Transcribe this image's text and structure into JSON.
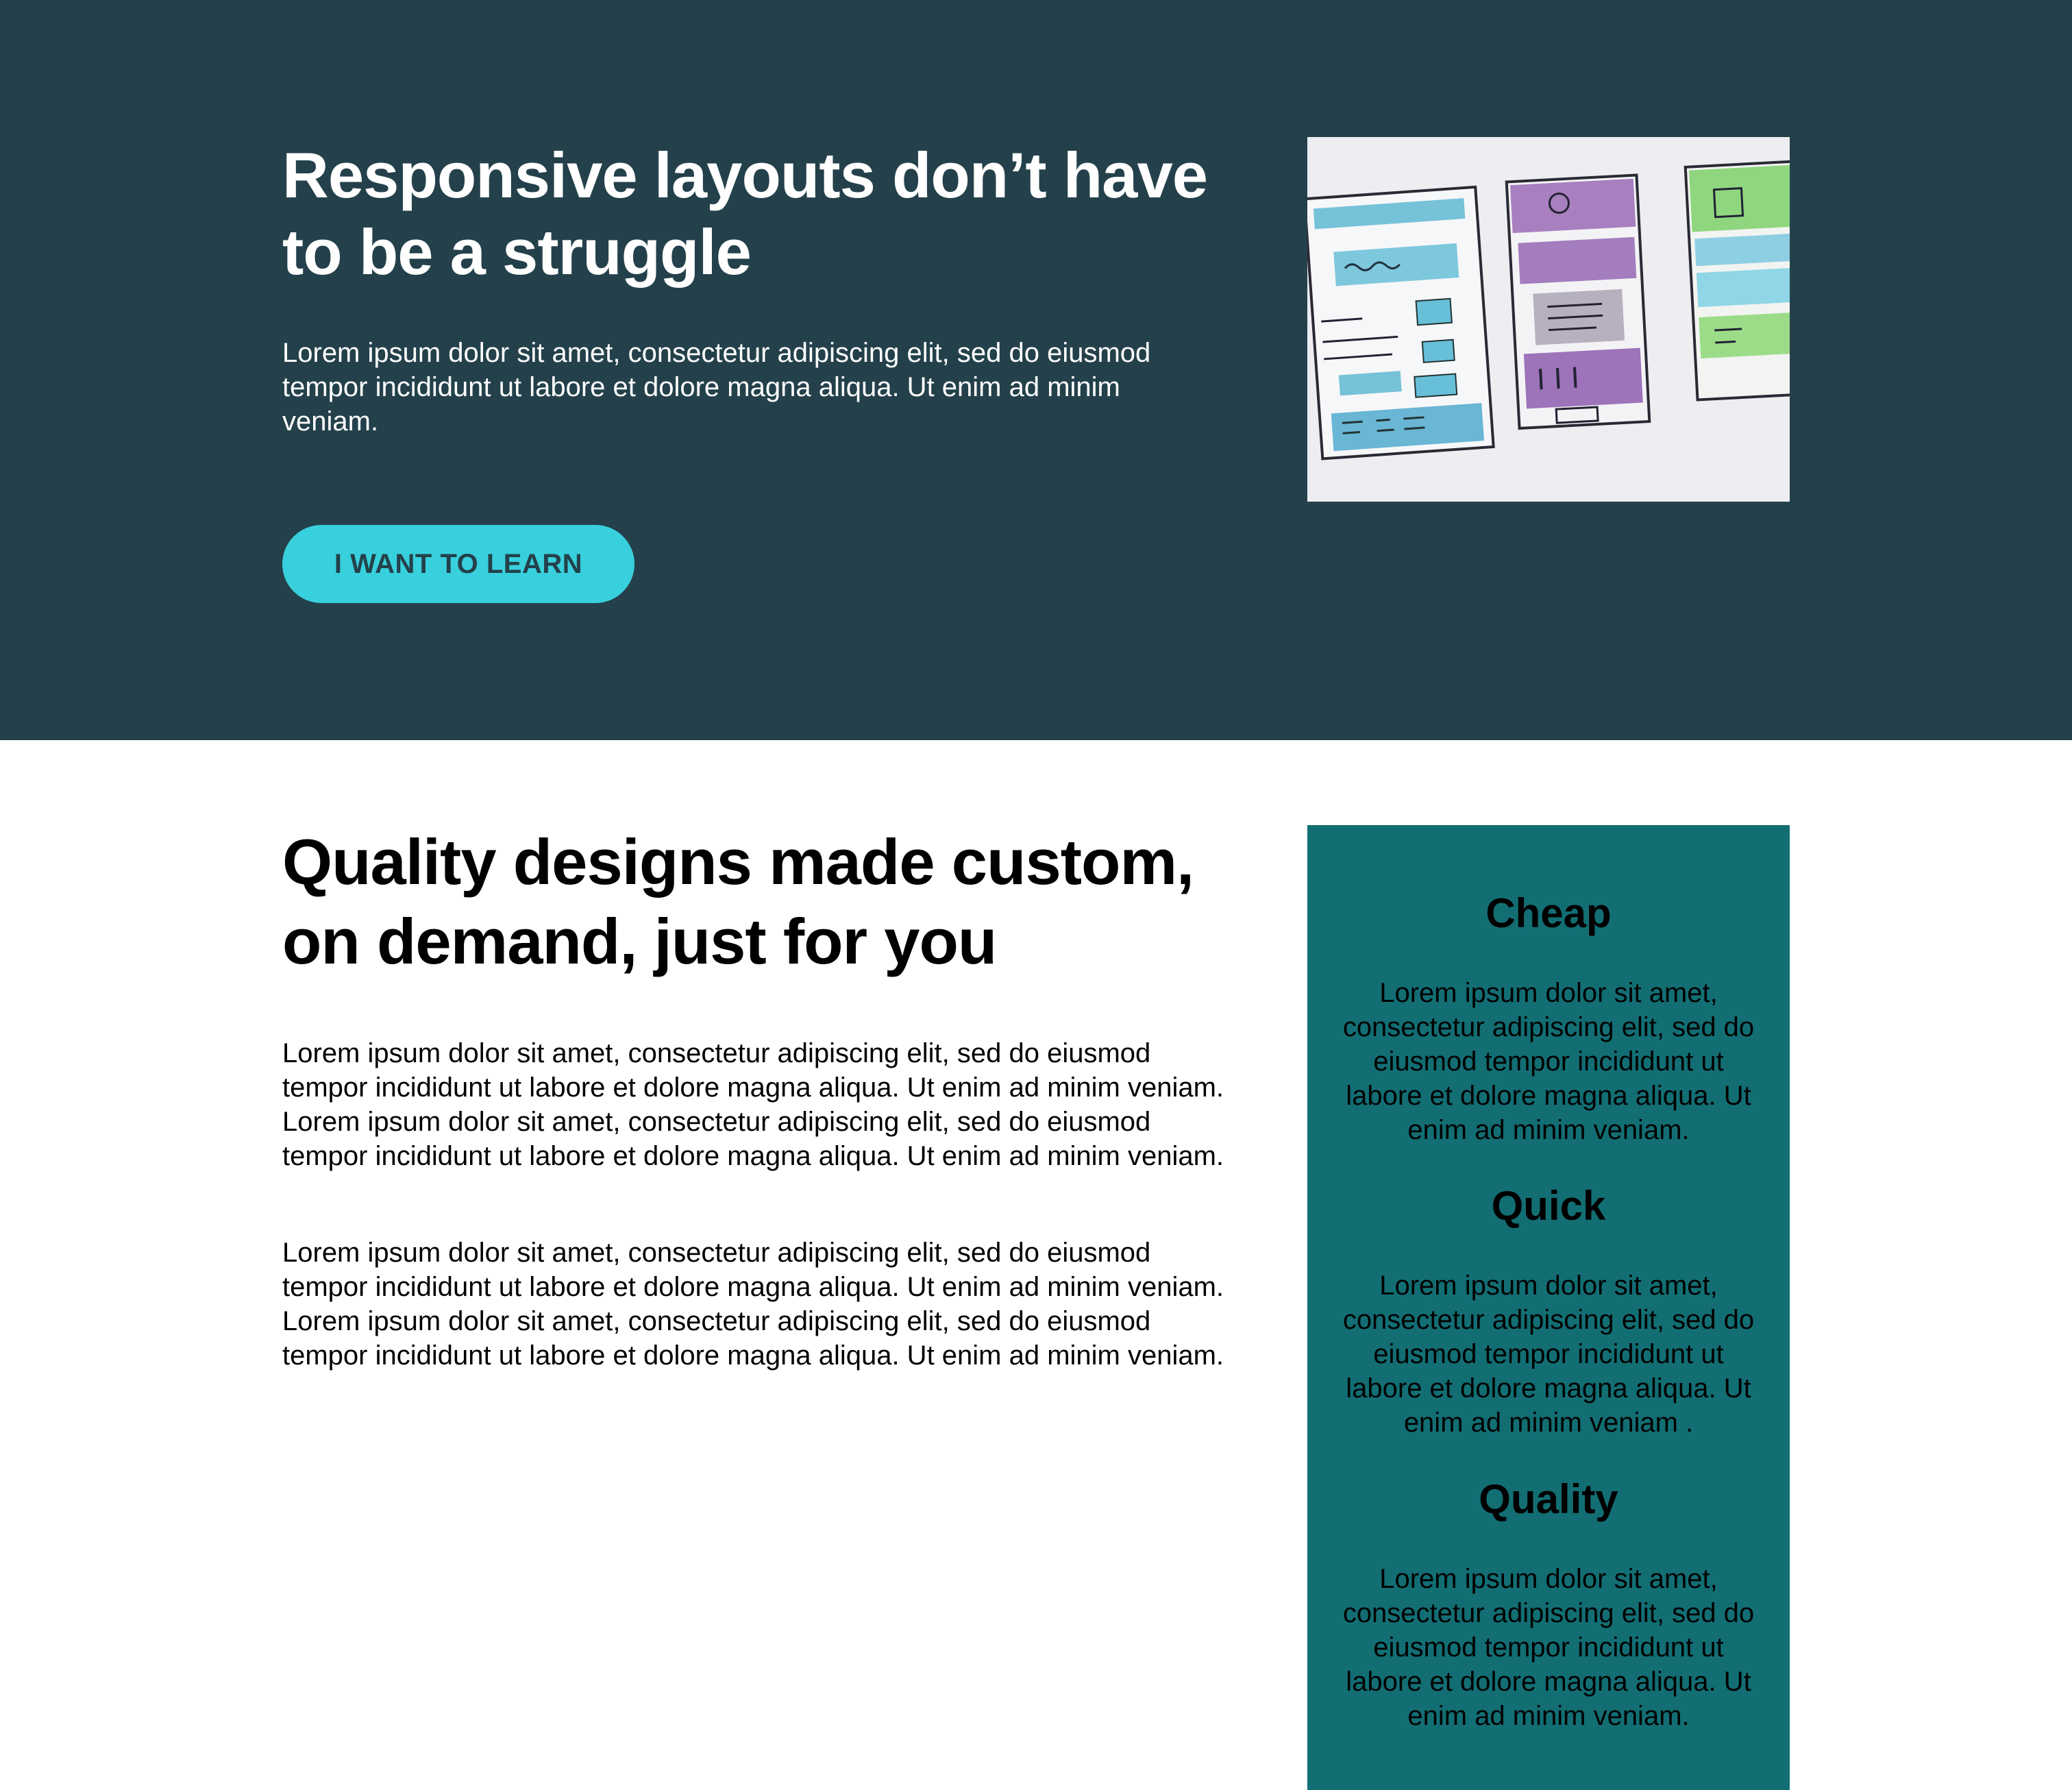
{
  "hero": {
    "title": "Responsive layouts don’t have to be a struggle",
    "text": "Lorem ipsum dolor sit amet, consectetur adipiscing elit, sed do eiusmod tempor incididunt ut labore et dolore magna aliqua. Ut enim ad minim veniam.",
    "cta_label": "I WANT TO LEARN"
  },
  "main": {
    "title": "Quality designs made custom, on demand, just for you",
    "paragraphs": [
      "Lorem ipsum dolor sit amet, consectetur adipiscing elit, sed do eiusmod tempor incididunt ut labore et dolore magna aliqua. Ut enim ad minim veniam. Lorem ipsum dolor sit amet, consectetur adipiscing elit, sed do eiusmod tempor incididunt ut labore et dolore magna aliqua. Ut enim ad minim veniam.",
      "Lorem ipsum dolor sit amet, consectetur adipiscing elit, sed do eiusmod tempor incididunt ut labore et dolore magna aliqua. Ut enim ad minim veniam. Lorem ipsum dolor sit amet, consectetur adipiscing elit, sed do eiusmod tempor incididunt ut labore et dolore magna aliqua. Ut enim ad minim veniam."
    ]
  },
  "sidebar": {
    "features": [
      {
        "title": "Cheap",
        "text": "Lorem ipsum dolor sit amet, consectetur adipiscing elit, sed do eiusmod tempor incididunt ut labore et dolore magna aliqua. Ut enim ad minim veniam."
      },
      {
        "title": "Quick",
        "text": "Lorem ipsum dolor sit amet, consectetur adipiscing elit, sed do eiusmod tempor incididunt ut labore et dolore magna aliqua. Ut enim ad minim veniam ."
      },
      {
        "title": "Quality",
        "text": "Lorem ipsum dolor sit amet, consectetur adipiscing elit, sed do eiusmod tempor incididunt ut labore et dolore magna aliqua. Ut enim ad minim veniam."
      }
    ]
  },
  "colors": {
    "hero_background": "#24414b",
    "accent": "#38d0dc",
    "sidebar_background": "#126e73"
  }
}
